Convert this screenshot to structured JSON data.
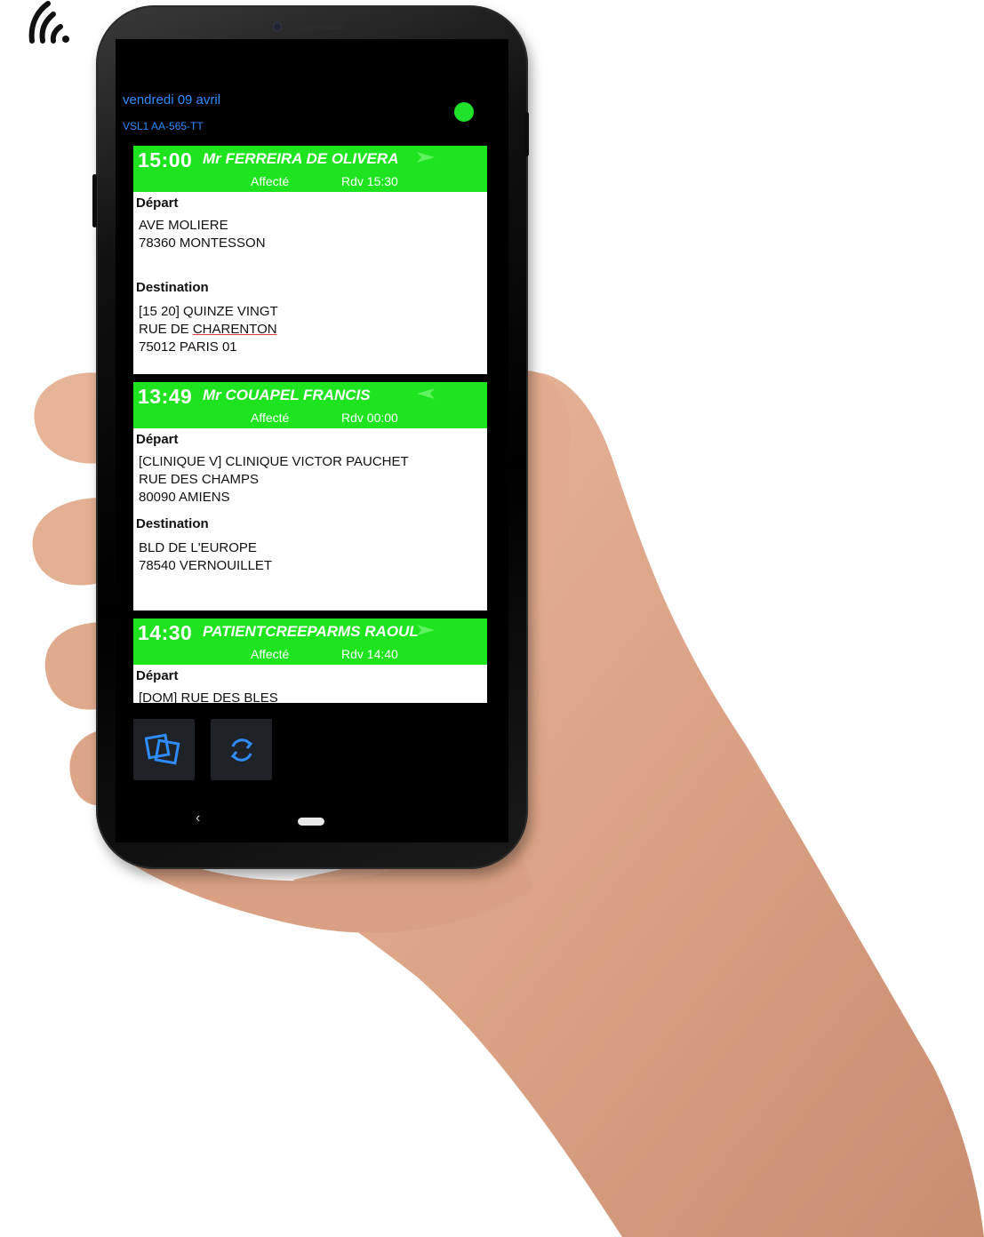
{
  "header": {
    "date": "vendredi 09 avril",
    "vehicle": "VSL1 AA-565-TT",
    "status_color": "#21e22a"
  },
  "missions": [
    {
      "time": "15:00",
      "patient": "Mr FERREIRA DE OLIVERA",
      "status": "Affecté",
      "rdv": "Rdv 15:30",
      "direction_icon": "send-arrow-icon",
      "depart_label": "Départ",
      "depart_lines": [
        "AVE MOLIERE",
        "78360 MONTESSON"
      ],
      "destination_label": "Destination",
      "destination_lines": [
        "[15 20] QUINZE VINGT",
        "RUE DE CHARENTON",
        "75012 PARIS 01"
      ]
    },
    {
      "time": "13:49",
      "patient": "Mr COUAPEL FRANCIS",
      "status": "Affecté",
      "rdv": "Rdv 00:00",
      "direction_icon": "return-arrow-icon",
      "depart_label": "Départ",
      "depart_lines": [
        "[CLINIQUE V] CLINIQUE VICTOR PAUCHET",
        "RUE DES CHAMPS",
        "80090 AMIENS"
      ],
      "destination_label": "Destination",
      "destination_lines": [
        "BLD DE L'EUROPE",
        "78540 VERNOUILLET"
      ]
    },
    {
      "time": "14:30",
      "patient": "PATIENTCREEPARMS RAOUL",
      "status": "Affecté",
      "rdv": "Rdv 14:40",
      "direction_icon": "send-arrow-icon",
      "depart_label": "Départ",
      "depart_lines": [
        "[DOM] RUE DES BLES"
      ]
    }
  ],
  "toolbar": {
    "left_button_icon": "overlapping-squares-icon",
    "right_button_icon": "refresh-icon",
    "accent": "#2f8cff"
  },
  "navbar": {
    "back": "‹"
  },
  "colors": {
    "card_header": "#1ee41f",
    "link_blue": "#2f8cff",
    "underline_red": "#e23a3a"
  }
}
